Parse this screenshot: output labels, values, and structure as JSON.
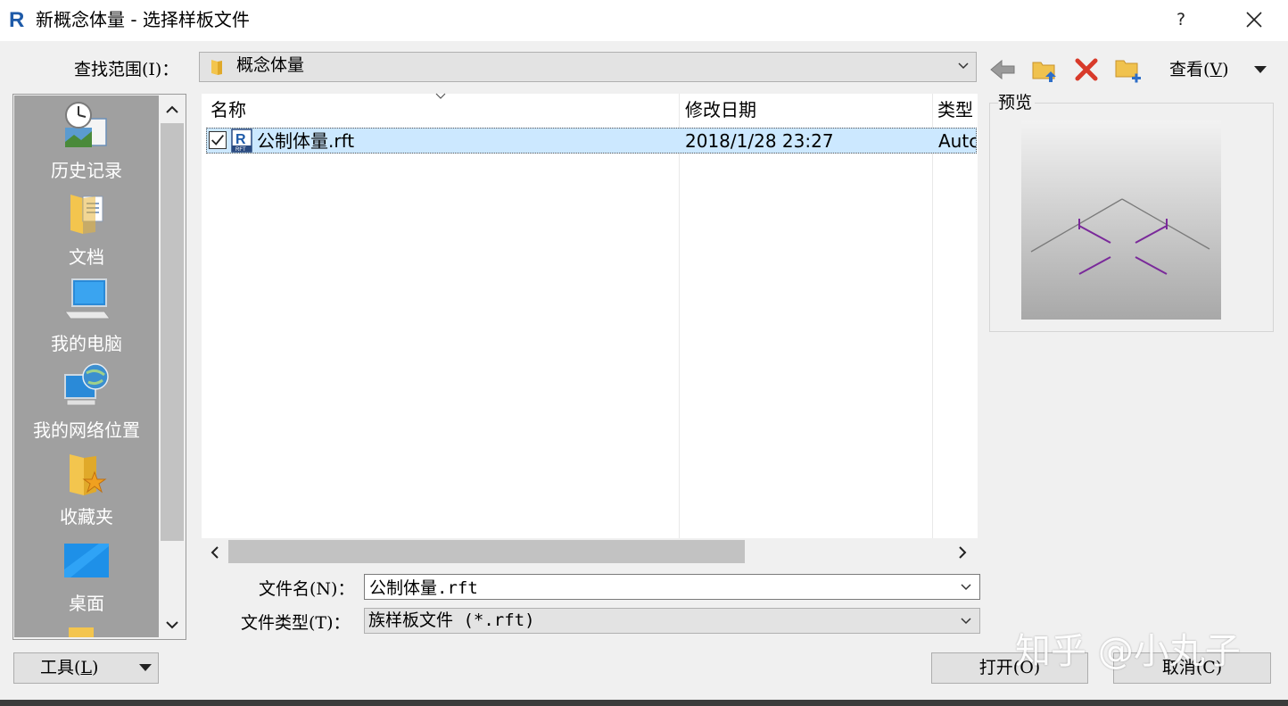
{
  "window": {
    "title": "新概念体量 - 选择样板文件",
    "help": "?",
    "accent": "#1e5aa8"
  },
  "lookin": {
    "label": "查找范围(I)：",
    "value": "概念体量"
  },
  "toolbar": {
    "views_label": "查看(V)"
  },
  "places": [
    {
      "label": "历史记录",
      "icon": "history-icon"
    },
    {
      "label": "文档",
      "icon": "documents-icon"
    },
    {
      "label": "我的电脑",
      "icon": "computer-icon"
    },
    {
      "label": "我的网络位置",
      "icon": "network-icon"
    },
    {
      "label": "收藏夹",
      "icon": "favorites-icon"
    },
    {
      "label": "桌面",
      "icon": "desktop-icon"
    }
  ],
  "filelist": {
    "columns": [
      "名称",
      "修改日期",
      "类型"
    ],
    "rows": [
      {
        "name": "公制体量.rft",
        "modified": "2018/1/28 23:27",
        "type": "Autc",
        "checked": true
      }
    ]
  },
  "preview": {
    "label": "预览"
  },
  "filename": {
    "label": "文件名(N)：",
    "value": "公制体量.rft"
  },
  "filetype": {
    "label": "文件类型(T)：",
    "value": "族样板文件 (*.rft)"
  },
  "buttons": {
    "tools": "工具(L)",
    "open": "打开(O)",
    "cancel": "取消(C)"
  },
  "watermark": "知乎 @小丸子"
}
